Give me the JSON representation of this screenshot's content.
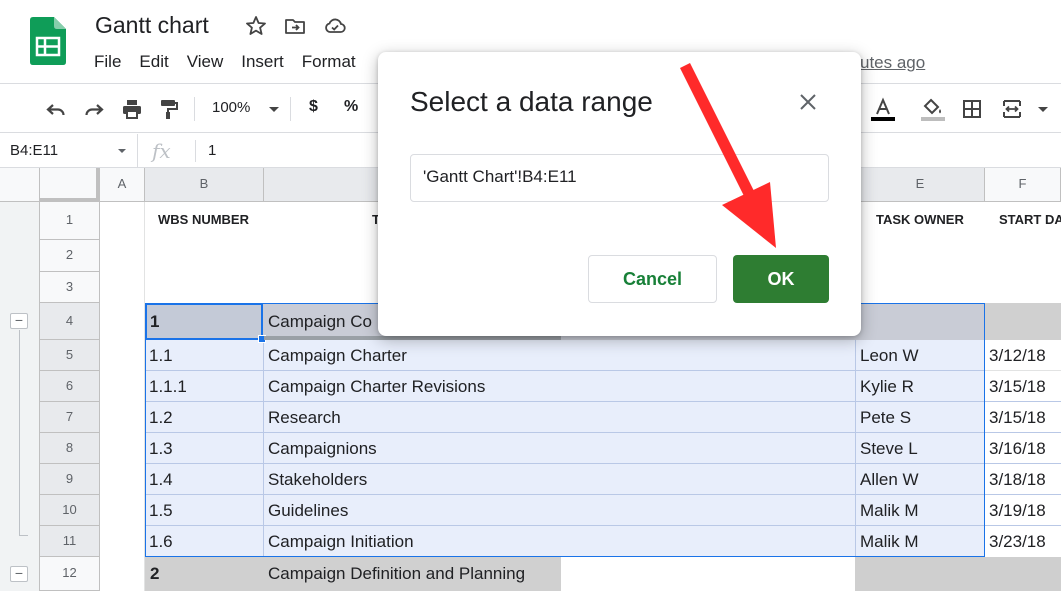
{
  "app": {
    "title": "Gantt chart",
    "menu": [
      "File",
      "Edit",
      "View",
      "Insert",
      "Format"
    ],
    "last_edit": "utes ago"
  },
  "toolbar": {
    "zoom": "100%",
    "currency": "$",
    "percent": "%"
  },
  "formula_bar": {
    "name_box": "B4:E11",
    "fx": "fx",
    "value": "1"
  },
  "sheet": {
    "columns": [
      "A",
      "B",
      "E",
      "F"
    ],
    "header_row": {
      "wbs": "WBS NUMBER",
      "title": "T",
      "owner": "TASK OWNER",
      "start": "START DA"
    },
    "row_numbers": [
      "1",
      "2",
      "3",
      "4",
      "5",
      "6",
      "7",
      "8",
      "9",
      "10",
      "11",
      "12"
    ],
    "rows": [
      {
        "wbs": "1",
        "task": "Campaign Co",
        "owner": "",
        "start": ""
      },
      {
        "wbs": "1.1",
        "task": "Campaign Charter",
        "owner": "Leon W",
        "start": "3/12/18"
      },
      {
        "wbs": "1.1.1",
        "task": "Campaign Charter Revisions",
        "owner": "Kylie R",
        "start": "3/15/18"
      },
      {
        "wbs": "1.2",
        "task": "Research",
        "owner": "Pete S",
        "start": "3/15/18"
      },
      {
        "wbs": "1.3",
        "task": "Campaignions",
        "owner": "Steve L",
        "start": "3/16/18"
      },
      {
        "wbs": "1.4",
        "task": "Stakeholders",
        "owner": "Allen W",
        "start": "3/18/18"
      },
      {
        "wbs": "1.5",
        "task": "Guidelines",
        "owner": "Malik M",
        "start": "3/19/18"
      },
      {
        "wbs": "1.6",
        "task": "Campaign Initiation",
        "owner": "Malik M",
        "start": "3/23/18"
      },
      {
        "wbs": "2",
        "task": "Campaign Definition and Planning",
        "owner": "",
        "start": ""
      }
    ]
  },
  "dialog": {
    "title": "Select a data range",
    "range_value": "'Gantt Chart'!B4:E11",
    "cancel_label": "Cancel",
    "ok_label": "OK"
  },
  "colors": {
    "selection_fill": "#e8eefb",
    "selection_border": "#1a73e8",
    "ok_green": "#2e7d32",
    "cancel_text": "#188038",
    "arrow_red": "#ff2a2a"
  }
}
